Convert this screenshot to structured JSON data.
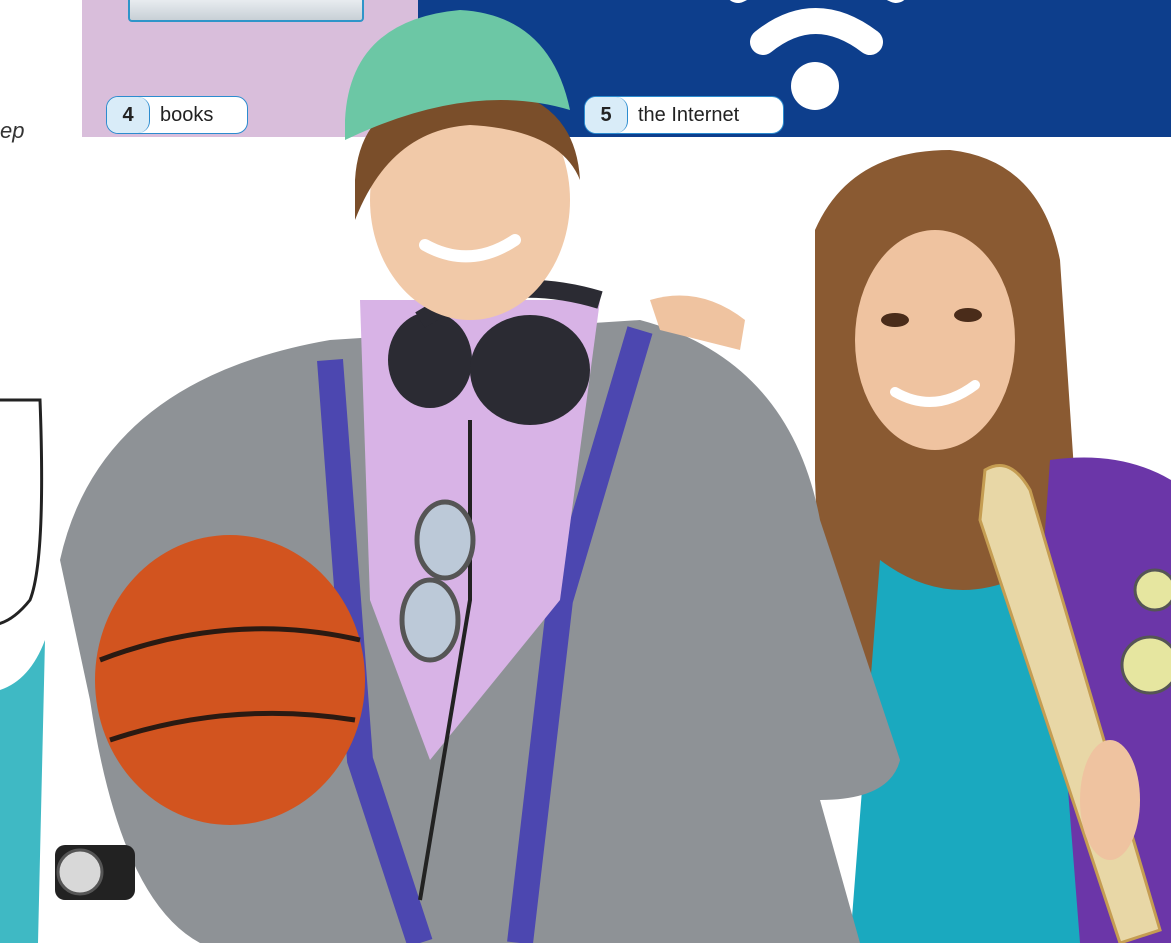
{
  "labels": [
    {
      "number": "4",
      "text": "books"
    },
    {
      "number": "5",
      "text": "the Internet"
    }
  ],
  "left_fragment": "ep",
  "icons": {
    "wifi": "wifi-icon"
  },
  "colors": {
    "lilac_band": "#d9bedb",
    "blue_band": "#0d3e8c",
    "pill_border": "#2c8ccf",
    "pill_number_bg": "#d9ecf8"
  }
}
